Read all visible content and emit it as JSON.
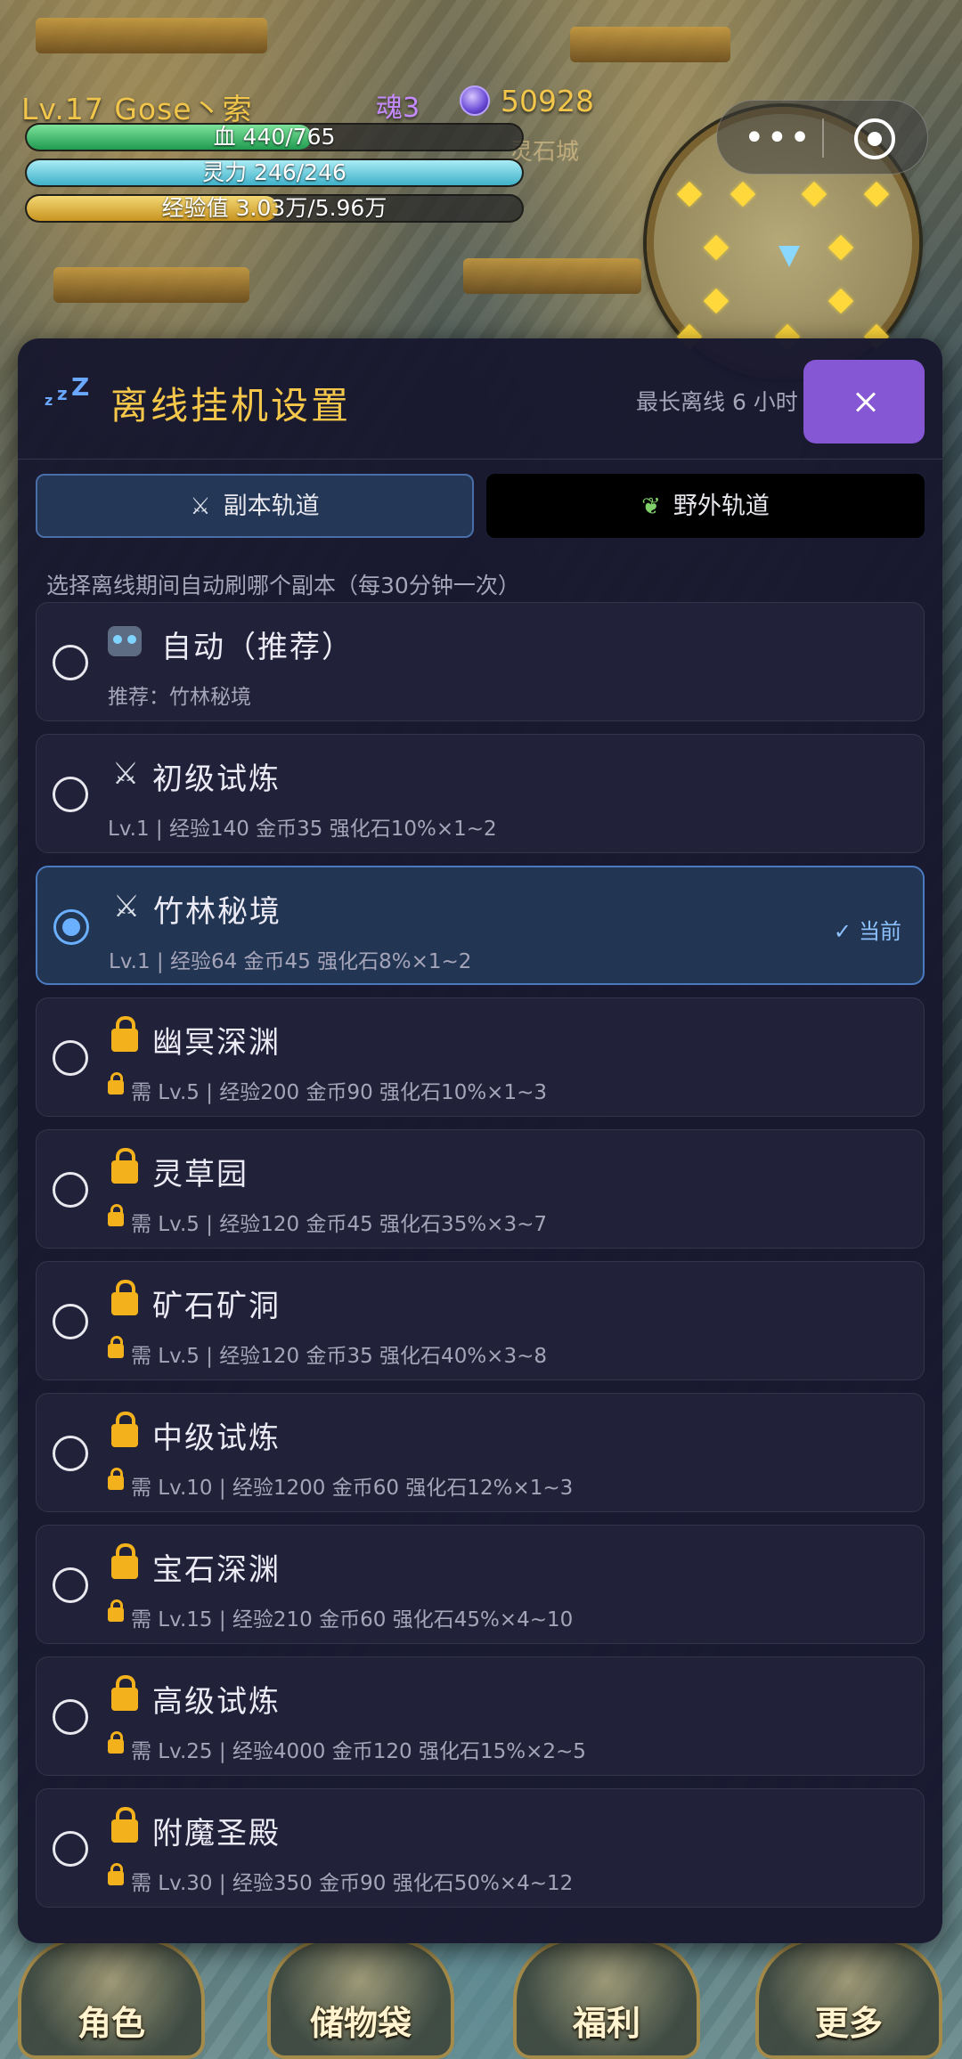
{
  "hud": {
    "player": "Lv.17 Gose丶索",
    "soul_label": "魂3",
    "gold": "50928",
    "realm": "灵石城",
    "hp": "血 440/765",
    "hp_ratio": 0.575,
    "mp": "灵力 246/246",
    "mp_ratio": 1.0,
    "xp": "经验值 3.03万/5.96万",
    "xp_ratio": 0.508
  },
  "modal": {
    "title": "离线挂机设置",
    "max_offline": "最长离线 6 小时",
    "tabs": [
      {
        "label": "副本轨道",
        "icon": "crossed-swords-icon"
      },
      {
        "label": "野外轨道",
        "icon": "sprout-icon"
      }
    ],
    "hint": "选择离线期间自动刷哪个副本（每30分钟一次）",
    "current_label": "当前",
    "items": [
      {
        "title": "自动（推荐）",
        "sub": "推荐：竹林秘境",
        "icon": "robot-icon"
      },
      {
        "title": "初级试炼",
        "sub": "Lv.1 | 经验140 金币35 强化石10%×1~2",
        "icon": "crossed-swords-icon"
      },
      {
        "title": "竹林秘境",
        "sub": "Lv.1 | 经验64 金币45 强化石8%×1~2",
        "icon": "crossed-swords-icon"
      },
      {
        "title": "幽冥深渊",
        "sub": "需 Lv.5 | 经验200 金币90 强化石10%×1~3",
        "icon": "lock-icon"
      },
      {
        "title": "灵草园",
        "sub": "需 Lv.5 | 经验120 金币45 强化石35%×3~7",
        "icon": "lock-icon"
      },
      {
        "title": "矿石矿洞",
        "sub": "需 Lv.5 | 经验120 金币35 强化石40%×3~8",
        "icon": "lock-icon"
      },
      {
        "title": "中级试炼",
        "sub": "需 Lv.10 | 经验1200 金币60 强化石12%×1~3",
        "icon": "lock-icon"
      },
      {
        "title": "宝石深渊",
        "sub": "需 Lv.15 | 经验210 金币60 强化石45%×4~10",
        "icon": "lock-icon"
      },
      {
        "title": "高级试炼",
        "sub": "需 Lv.25 | 经验4000 金币120 强化石15%×2~5",
        "icon": "lock-icon"
      },
      {
        "title": "附魔圣殿",
        "sub": "需 Lv.30 | 经验350 金币90 强化石50%×4~12",
        "icon": "lock-icon"
      }
    ]
  },
  "nav": [
    "角色",
    "储物袋",
    "福利",
    "更多"
  ]
}
